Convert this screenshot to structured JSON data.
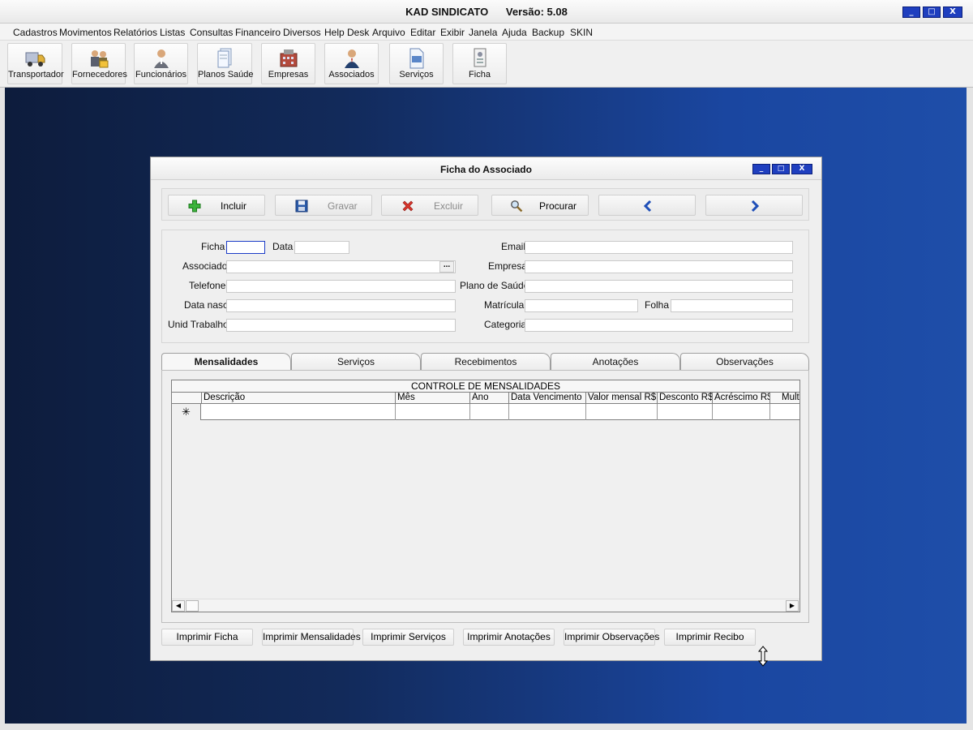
{
  "app": {
    "title": "KAD SINDICATO      Versão: 5.08",
    "controls": {
      "minimize": "_",
      "maximize": "□",
      "close": "X"
    }
  },
  "menubar": {
    "items": [
      "Cadastros",
      "Movimentos",
      "Relatórios",
      "Listas",
      "Consultas",
      "Financeiro",
      "Diversos",
      "Help Desk",
      "Arquivo",
      "Editar",
      "Exibir",
      "Janela",
      "Ajuda",
      "Backup",
      "SKIN"
    ]
  },
  "toolbar": {
    "buttons": [
      {
        "label": "Transportador",
        "icon": "truck-icon"
      },
      {
        "label": "Fornecedores",
        "icon": "suppliers-icon"
      },
      {
        "label": "Funcionários",
        "icon": "employee-icon"
      },
      {
        "label": "Planos Saúde",
        "icon": "document-stack-icon"
      },
      {
        "label": "Empresas",
        "icon": "building-icon"
      },
      {
        "label": "Associados",
        "icon": "associate-icon"
      },
      {
        "label": "Serviços",
        "icon": "page-icon"
      },
      {
        "label": "Ficha",
        "icon": "card-icon"
      }
    ]
  },
  "dialog": {
    "title": "Ficha do Associado",
    "controls": {
      "minimize": "_",
      "maximize": "□",
      "close": "X"
    },
    "actions": [
      {
        "label": "Incluir",
        "icon": "plus-icon",
        "enabled": true
      },
      {
        "label": "Gravar",
        "icon": "save-icon",
        "enabled": false
      },
      {
        "label": "Excluir",
        "icon": "delete-icon",
        "enabled": false
      },
      {
        "label": "Procurar",
        "icon": "search-icon",
        "enabled": true
      },
      {
        "label": "",
        "icon": "previous-icon",
        "enabled": true
      },
      {
        "label": "",
        "icon": "next-icon",
        "enabled": true
      }
    ],
    "fields": {
      "ficha": {
        "label": "Ficha",
        "value": ""
      },
      "data": {
        "label": "Data",
        "value": ""
      },
      "associado": {
        "label": "Associado",
        "value": "",
        "lookup": "..."
      },
      "telefone": {
        "label": "Telefone",
        "value": ""
      },
      "data_nasc": {
        "label": "Data nasc",
        "value": ""
      },
      "unid_trabalho": {
        "label": "Unid Trabalho",
        "value": ""
      },
      "email": {
        "label": "Email",
        "value": ""
      },
      "empresa": {
        "label": "Empresa",
        "value": ""
      },
      "plano_saude": {
        "label": "Plano de Saúde",
        "value": ""
      },
      "matricula": {
        "label": "Matrícula",
        "value": ""
      },
      "folha": {
        "label": "Folha",
        "value": ""
      },
      "categoria": {
        "label": "Categoria",
        "value": ""
      }
    },
    "tabs": [
      "Mensalidades",
      "Serviços",
      "Recebimentos",
      "Anotações",
      "Observações"
    ],
    "active_tab": "Mensalidades",
    "grid": {
      "caption": "CONTROLE DE MENSALIDADES",
      "columns": [
        "Descrição",
        "Mês",
        "Ano",
        "Data Vencimento",
        "Valor mensal R$",
        "Desconto R$",
        "Acréscimo R$",
        "Multa"
      ],
      "new_row_marker": "✳"
    },
    "print_buttons": [
      "Imprimir Ficha",
      "Imprimir Mensalidades",
      "Imprimir Serviços",
      "Imprimir Anotações",
      "Imprimir Observações",
      "Imprimir Recibo"
    ]
  },
  "colors": {
    "window_control": "#1f3fbf",
    "desktop_dark": "#0d1c3c",
    "desktop_light": "#1e4ea9",
    "focus_border": "#1c3cc7"
  }
}
